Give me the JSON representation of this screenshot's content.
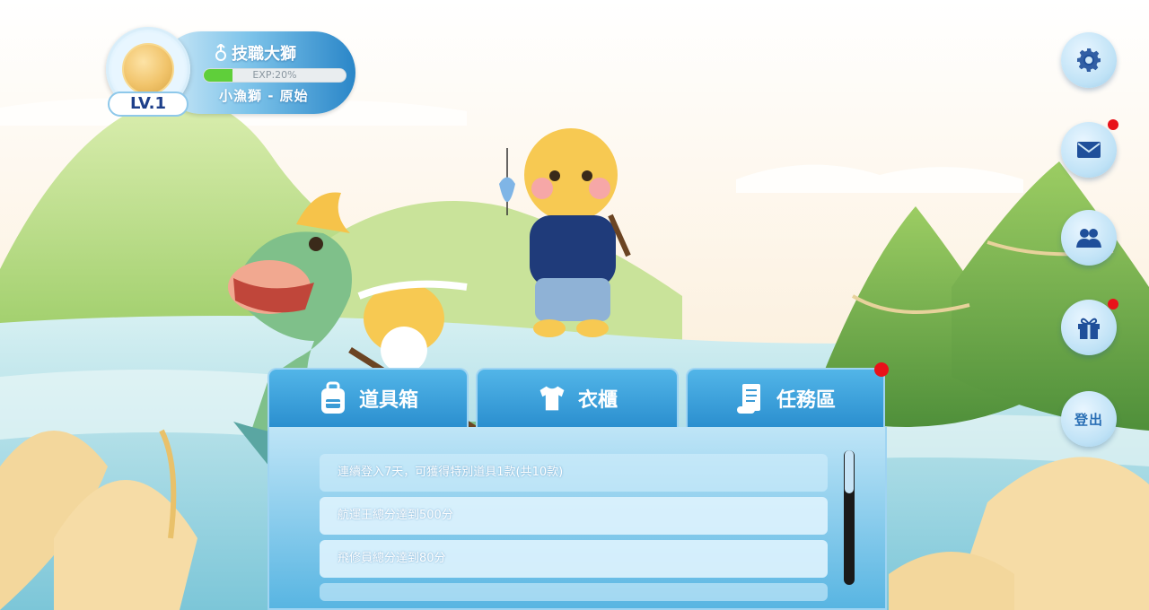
{
  "player": {
    "name": "技職大獅",
    "level_label": "LV.1",
    "exp_label": "EXP:20%",
    "exp_progress": 0.2,
    "title": "小漁獅 - 原始",
    "gender_icon": "male-icon",
    "avatar_icon": "gold-coin-avatar"
  },
  "side_buttons": [
    {
      "name": "settings",
      "icon": "gear-icon",
      "has_notification": false
    },
    {
      "name": "mail",
      "icon": "envelope-icon",
      "has_notification": true
    },
    {
      "name": "friends",
      "icon": "users-icon",
      "has_notification": false
    },
    {
      "name": "gift",
      "icon": "gift-icon",
      "has_notification": true
    },
    {
      "name": "logout",
      "label": "登出"
    }
  ],
  "tabs": [
    {
      "label": "道具箱",
      "icon": "backpack-icon",
      "has_notification": false
    },
    {
      "label": "衣櫃",
      "icon": "tshirt-icon",
      "has_notification": false
    },
    {
      "label": "任務區",
      "icon": "scroll-icon",
      "has_notification": true
    }
  ],
  "tasks": [
    {
      "text": "連續登入7天，可獲得特別道具1款(共10款)"
    },
    {
      "text": "航運王總分達到500分"
    },
    {
      "text": "飛修員總分達到80分"
    }
  ],
  "colors": {
    "accent": "#2b8fcf",
    "level_text": "#1d3f8a",
    "exp_fill": "#5fcf3a",
    "notification": "#e8121a"
  },
  "scene": "dragon-boat-festival-background"
}
